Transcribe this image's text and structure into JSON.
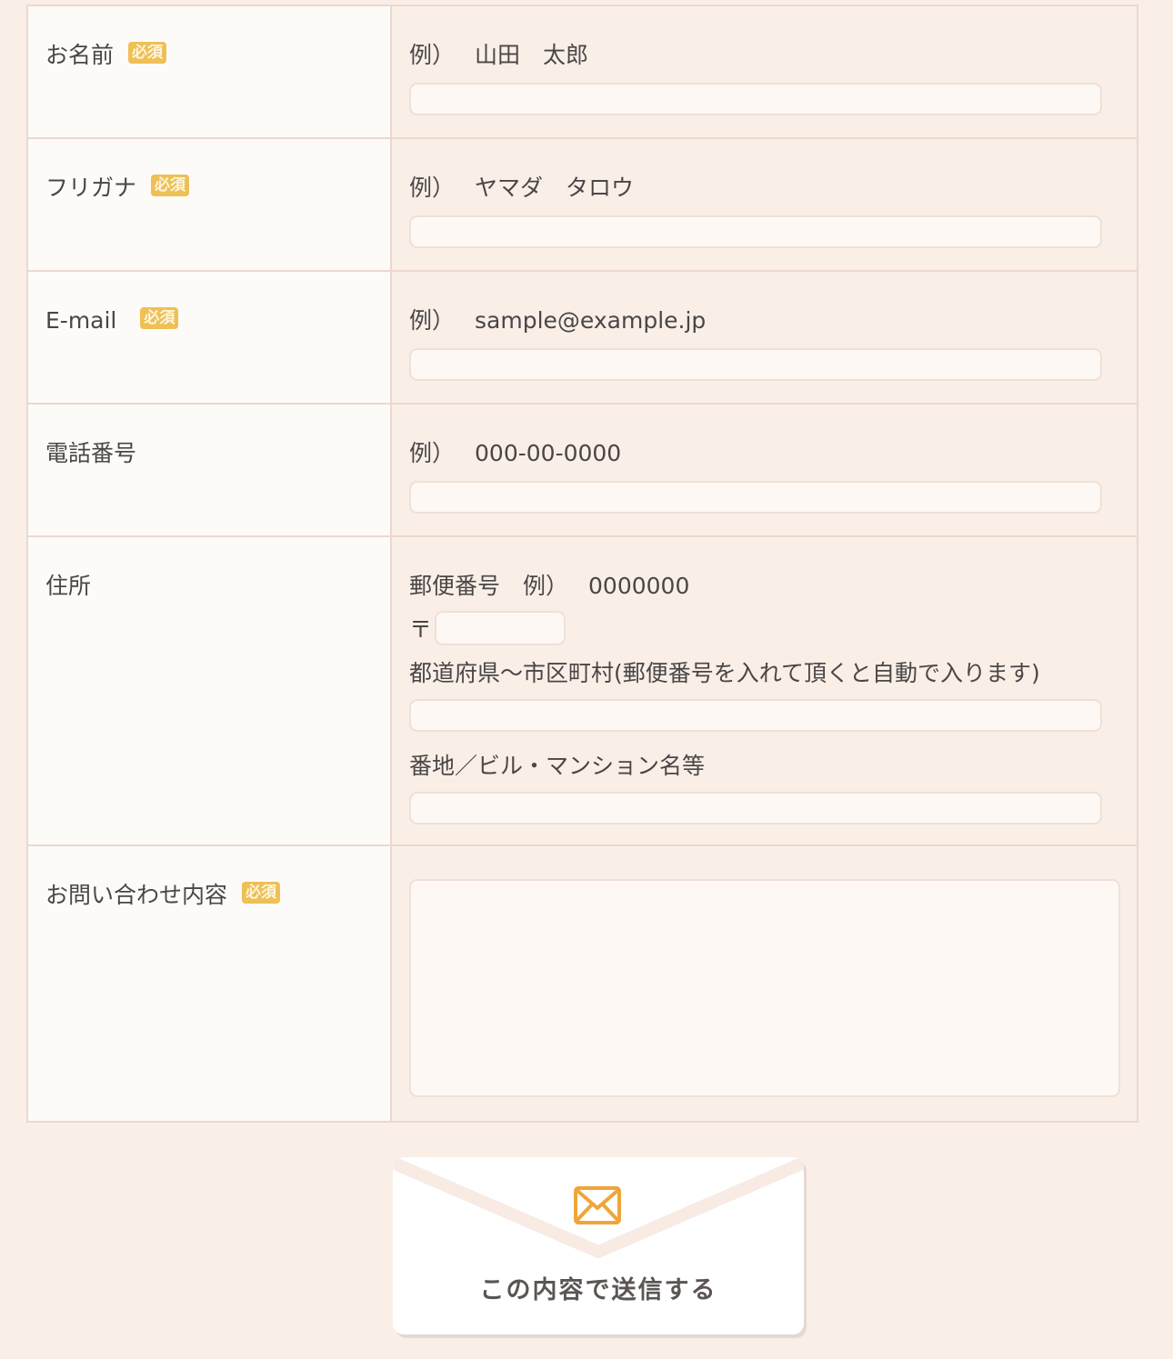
{
  "required_badge": "必須",
  "fields": {
    "name": {
      "label": "お名前",
      "example_mark": "例）",
      "example": "山田　太郎",
      "value": ""
    },
    "furigana": {
      "label": "フリガナ",
      "example_mark": "例）",
      "example": "ヤマダ　タロウ",
      "value": ""
    },
    "email": {
      "label": "E-mail",
      "example_mark": "例）",
      "example": "sample@example.jp",
      "value": ""
    },
    "phone": {
      "label": "電話番号",
      "example_mark": "例）",
      "example": "000-00-0000",
      "value": ""
    },
    "address": {
      "label": "住所",
      "postal_label": "郵便番号　例）",
      "postal_example": "0000000",
      "postal_mark": "〒",
      "postal_value": "",
      "prefecture_label": "都道府県～市区町村(郵便番号を入れて頂くと自動で入ります)",
      "prefecture_value": "",
      "street_label": "番地／ビル・マンション名等",
      "street_value": ""
    },
    "message": {
      "label": "お問い合わせ内容",
      "value": ""
    }
  },
  "submit": {
    "label": "この内容で送信する",
    "icon": "mail-icon",
    "accent_color": "#eea63a"
  },
  "colors": {
    "background": "#f9efe7",
    "label_cell": "#fdfbf8",
    "border": "#ecd8cf",
    "badge": "#eec055"
  }
}
